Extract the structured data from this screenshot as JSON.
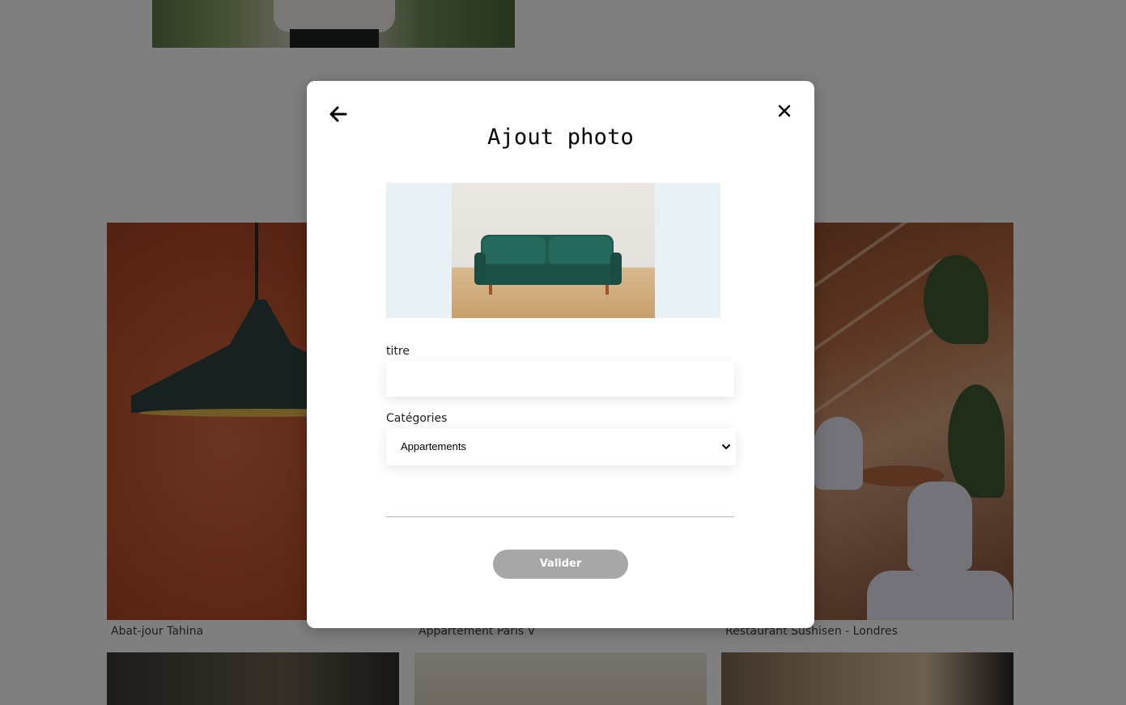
{
  "gallery": {
    "works": [
      {
        "caption": "Abat-jour Tahina"
      },
      {
        "caption": "Appartement Paris V"
      },
      {
        "caption": "Restaurant Sushisen - Londres"
      }
    ]
  },
  "modal": {
    "title": "Ajout photo",
    "back_icon": "arrow-left-icon",
    "close_icon": "close-icon",
    "form": {
      "title_label": "titre",
      "title_value": "",
      "category_label": "Catégories",
      "category_selected": "Appartements",
      "submit_label": "Valider"
    }
  },
  "colors": {
    "submit_button_bg": "#a7a7a7",
    "preview_bg": "#e8f1f6",
    "overlay": "rgba(0,0,0,0.5)"
  }
}
